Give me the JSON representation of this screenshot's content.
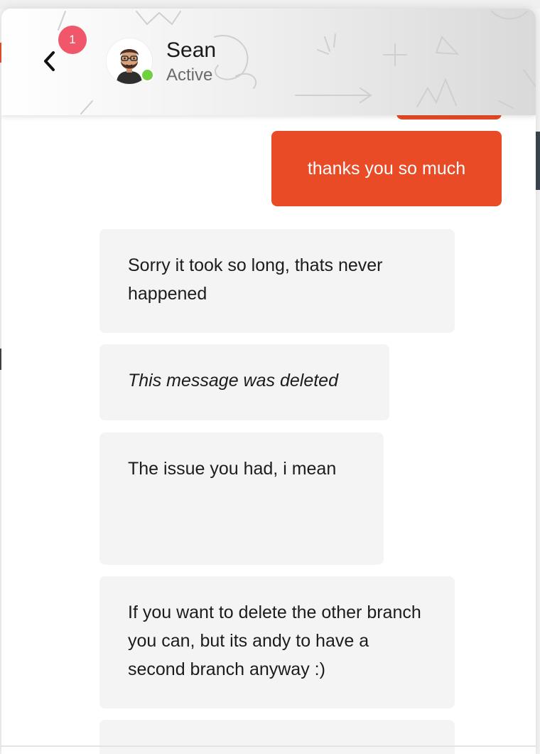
{
  "header": {
    "back_icon": "chevron-left-icon",
    "unread_count": "1",
    "contact": {
      "name": "Sean",
      "status": "Active",
      "avatar_icon": "bearded-man-avatar-icon",
      "online_color": "#6fd13f"
    }
  },
  "messages": [
    {
      "direction": "outgoing",
      "text": "thanks you so much"
    },
    {
      "direction": "incoming",
      "text": "Sorry it took so long, thats never happened"
    },
    {
      "direction": "incoming",
      "text": "This message was deleted",
      "deleted": true
    },
    {
      "direction": "incoming",
      "text": "The issue you had, i mean"
    },
    {
      "direction": "incoming",
      "text": "If you want to delete the other branch you can, but its andy to have a second branch anyway :)"
    }
  ],
  "colors": {
    "outgoing_bubble": "#e84b25",
    "incoming_bubble": "#f4f4f4",
    "badge": "#f0576a",
    "online": "#6fd13f"
  }
}
